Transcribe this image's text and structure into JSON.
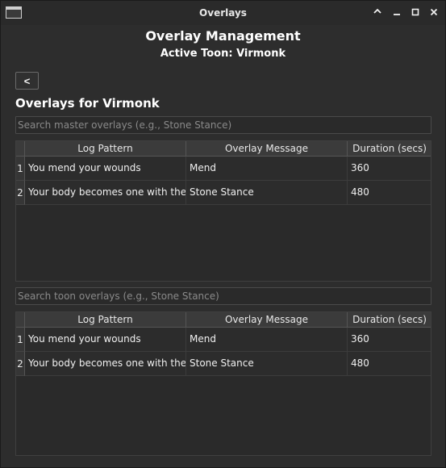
{
  "window": {
    "title": "Overlays",
    "controls": {
      "up_icon": "chevron-up-icon",
      "minimize_icon": "minimize-icon",
      "maximize_icon": "maximize-icon",
      "close_icon": "close-icon"
    }
  },
  "header": {
    "title": "Overlay Management",
    "subtitle": "Active Toon: Virmonk"
  },
  "back_button": {
    "label": "<"
  },
  "section": {
    "title": "Overlays for Virmonk"
  },
  "master": {
    "search_placeholder": "Search master overlays (e.g., Stone Stance)",
    "columns": [
      "Log Pattern",
      "Overlay Message",
      "Duration (secs)"
    ],
    "rows": [
      {
        "num": "1",
        "pattern": "You mend your wounds",
        "message": "Mend",
        "duration": "360"
      },
      {
        "num": "2",
        "pattern": "Your body becomes one with the...",
        "message": "Stone Stance",
        "duration": "480"
      }
    ]
  },
  "toon": {
    "search_placeholder": "Search toon overlays (e.g., Stone Stance)",
    "columns": [
      "Log Pattern",
      "Overlay Message",
      "Duration (secs)"
    ],
    "rows": [
      {
        "num": "1",
        "pattern": "You mend your wounds",
        "message": "Mend",
        "duration": "360"
      },
      {
        "num": "2",
        "pattern": "Your body becomes one with the...",
        "message": "Stone Stance",
        "duration": "480"
      }
    ]
  },
  "colors": {
    "background": "#2d2d2d",
    "header_bg": "#3b3b3b",
    "text": "#e8e8e8"
  }
}
